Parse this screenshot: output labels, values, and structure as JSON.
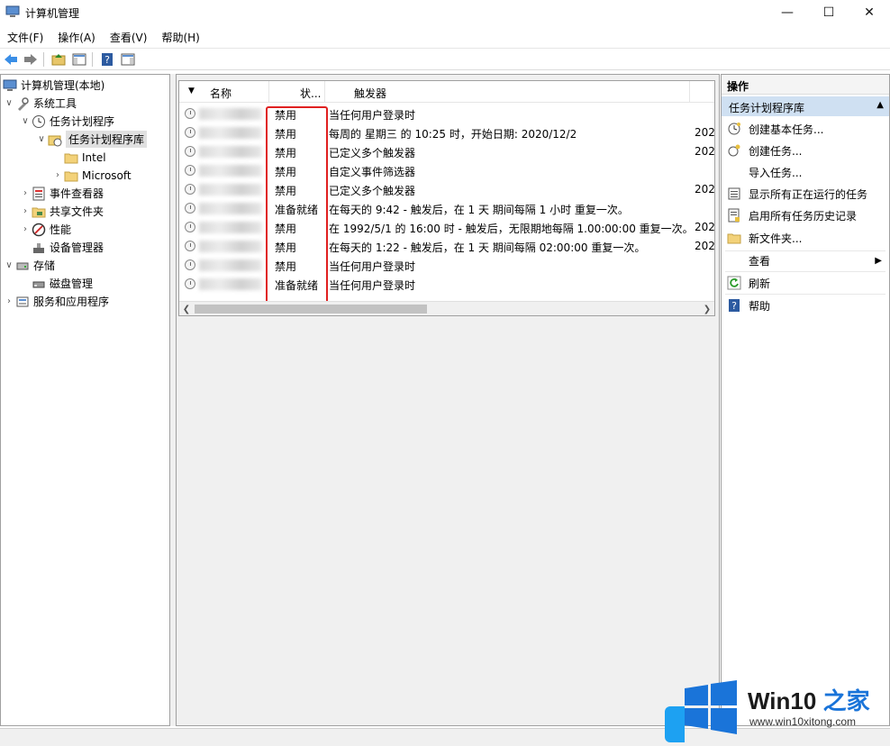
{
  "window": {
    "title": "计算机管理"
  },
  "menu": [
    "文件(F)",
    "操作(A)",
    "查看(V)",
    "帮助(H)"
  ],
  "tree": [
    {
      "label": "计算机管理(本地)"
    },
    {
      "label": "系统工具"
    },
    {
      "label": "任务计划程序"
    },
    {
      "label": "任务计划程序库"
    },
    {
      "label": "Intel"
    },
    {
      "label": "Microsoft"
    },
    {
      "label": "事件查看器"
    },
    {
      "label": "共享文件夹"
    },
    {
      "label": "性能"
    },
    {
      "label": "设备管理器"
    },
    {
      "label": "存储"
    },
    {
      "label": "磁盘管理"
    },
    {
      "label": "服务和应用程序"
    }
  ],
  "list": {
    "columns": [
      "名称",
      "状...",
      "触发器"
    ],
    "rows": [
      {
        "status": "禁用",
        "trigger": "当任何用户登录时",
        "extra": ""
      },
      {
        "status": "禁用",
        "trigger": "每周的 星期三 的 10:25 时，开始日期: 2020/12/2",
        "extra": "202"
      },
      {
        "status": "禁用",
        "trigger": "已定义多个触发器",
        "extra": "202"
      },
      {
        "status": "禁用",
        "trigger": "自定义事件筛选器",
        "extra": ""
      },
      {
        "status": "禁用",
        "trigger": "已定义多个触发器",
        "extra": "202"
      },
      {
        "status": "准备就绪",
        "trigger": "在每天的 9:42 - 触发后，在 1 天 期间每隔 1 小时 重复一次。",
        "extra": ""
      },
      {
        "status": "禁用",
        "trigger": "在 1992/5/1 的 16:00 时 - 触发后，无限期地每隔 1.00:00:00 重复一次。",
        "extra": "202"
      },
      {
        "status": "禁用",
        "trigger": "在每天的 1:22 - 触发后，在 1 天 期间每隔 02:00:00 重复一次。",
        "extra": "202"
      },
      {
        "status": "禁用",
        "trigger": "当任何用户登录时",
        "extra": ""
      },
      {
        "status": "准备就绪",
        "trigger": "当任何用户登录时",
        "extra": ""
      }
    ]
  },
  "actions": {
    "title": "操作",
    "section": "任务计划程序库",
    "items": [
      "创建基本任务...",
      "创建任务...",
      "导入任务...",
      "显示所有正在运行的任务",
      "启用所有任务历史记录",
      "新文件夹...",
      "查看",
      "刷新",
      "帮助"
    ]
  },
  "watermark": {
    "brand_main": "Win10",
    "brand_accent": "之家",
    "url": "www.win10xitong.com"
  },
  "colors": {
    "highlight_box": "#e02020",
    "section_bg": "#cfe0f2",
    "win_logo": "#1a74d9"
  }
}
